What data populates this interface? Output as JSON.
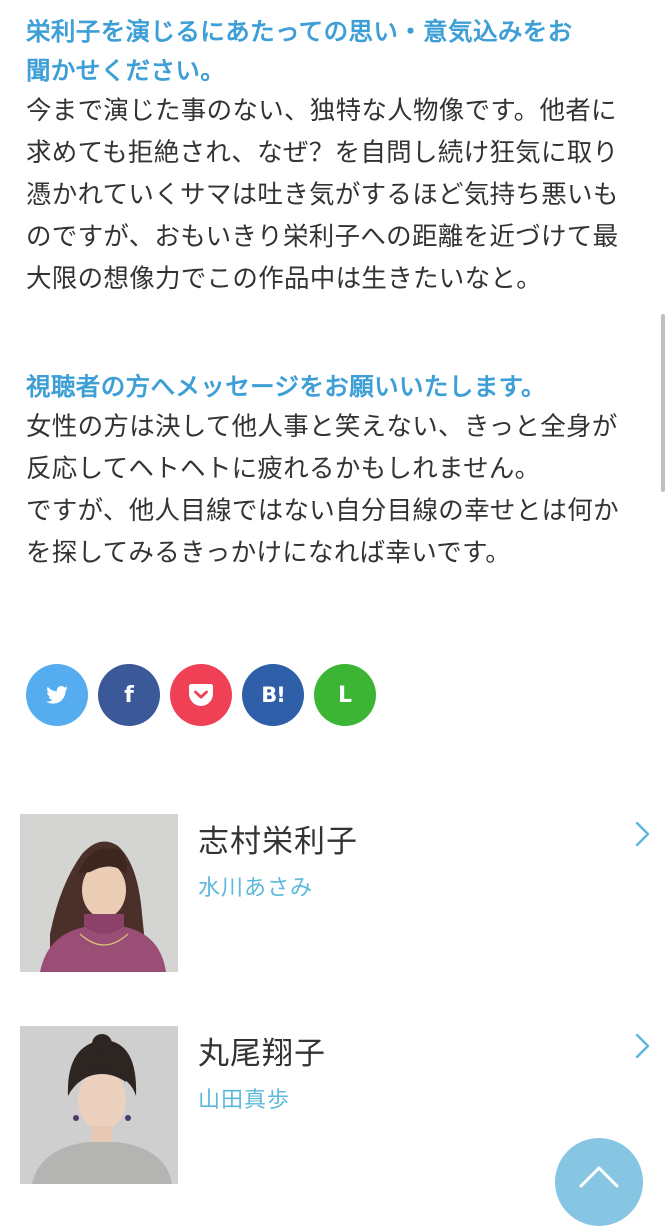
{
  "interview": [
    {
      "question": [
        "栄利子を演じるにあたっての思い・意気込みをお",
        "聞かせください。"
      ],
      "answer": [
        "今まで演じた事のない、独特な人物像です。他者に",
        "求めても拒絶され、なぜ？を自問し続け狂気に取り",
        "憑かれていくサマは吐き気がするほど気持ち悪いも",
        "のですが、おもいきり栄利子への距離を近づけて最",
        "大限の想像力でこの作品中は生きたいなと。"
      ]
    },
    {
      "question": [
        "視聴者の方へメッセージをお願いいたします。"
      ],
      "answer": [
        "女性の方は決して他人事と笑えない、きっと全身が",
        "反応してヘトヘトに疲れるかもしれません。",
        "ですが、他人目線ではない自分目線の幸せとは何か",
        "を探してみるきっかけになれば幸いです。"
      ]
    }
  ],
  "share_buttons": [
    {
      "name": "twitter",
      "icon": "twitter-bird-icon",
      "color": "#55acee",
      "label": ""
    },
    {
      "name": "facebook",
      "icon": "facebook-icon",
      "color": "#3b5998",
      "label": "f"
    },
    {
      "name": "pocket",
      "icon": "pocket-icon",
      "color": "#ef4056",
      "label": ""
    },
    {
      "name": "hatena",
      "icon": "hatena-bookmark-icon",
      "color": "#2f5fa8",
      "label": "B!"
    },
    {
      "name": "line",
      "icon": "line-icon",
      "color": "#3cb534",
      "label": "L"
    }
  ],
  "cast": [
    {
      "role": "志村栄利子",
      "actor": "水川あさみ",
      "icon": "chevron-right-icon"
    },
    {
      "role": "丸尾翔子",
      "actor": "山田真歩",
      "icon": "chevron-right-icon"
    }
  ],
  "colors": {
    "heading": "#3e9fd6",
    "actor": "#5cb8dc",
    "back_to_top": "#86c6e3"
  },
  "back_to_top_icon": "chevron-up-icon"
}
